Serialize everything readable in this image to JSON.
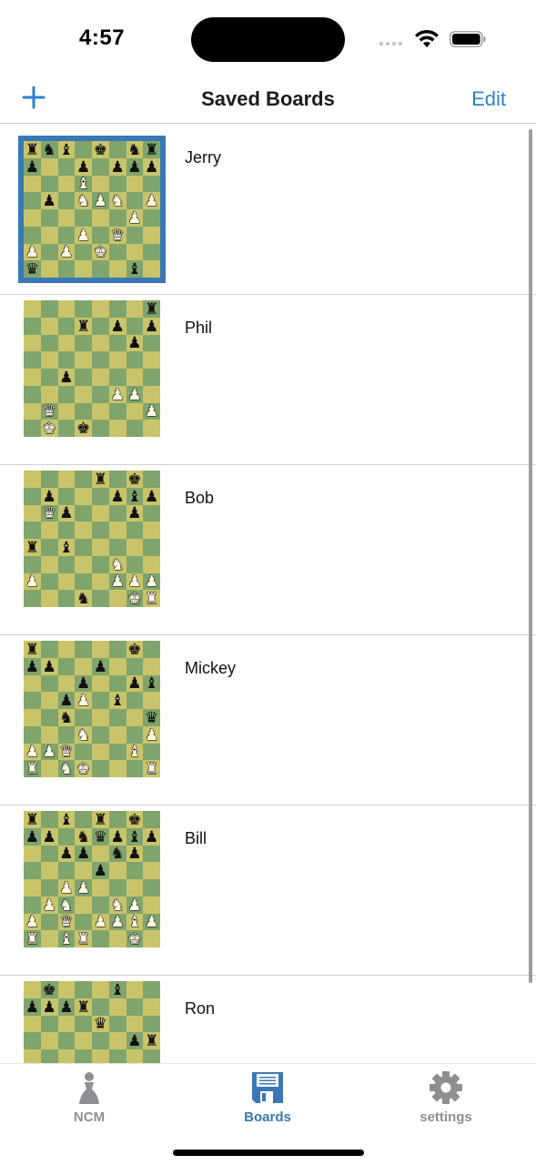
{
  "status_bar": {
    "time": "4:57"
  },
  "nav": {
    "title": "Saved Boards",
    "add_icon": "plus-icon",
    "edit_label": "Edit"
  },
  "colors": {
    "accent": "#2f80d1",
    "tab_active": "#3a78b5",
    "tab_inactive": "#8e8e93",
    "light_square": "#c9c46a",
    "dark_square": "#80a56c",
    "selection_border": "#3a78b5"
  },
  "boards": [
    {
      "name": "Jerry",
      "selected": true,
      "ranks": [
        "rnb.k.nr",
        "p..p.ppp",
        "...B....",
        ".p.NPN.P",
        "......P.",
        "...P.Q..",
        "P.P.K...",
        "q.....b."
      ]
    },
    {
      "name": "Phil",
      "selected": false,
      "ranks": [
        ".......r",
        "...r.p.p",
        "......p.",
        "........",
        "..p.....",
        ".....PP.",
        ".Q.....P",
        ".K.k...."
      ]
    },
    {
      "name": "Bob",
      "selected": false,
      "ranks": [
        "....r.k.",
        ".p...pbp",
        ".Qp...p.",
        "........",
        "r.b.....",
        ".....N..",
        "P....PPP",
        "...n..KR"
      ]
    },
    {
      "name": "Mickey",
      "selected": false,
      "ranks": [
        "r.....k.",
        "pp..p...",
        "...p..pb",
        "..pP.b..",
        "..n....q",
        "...N...P",
        "PPQ...B.",
        "R.NK...R"
      ]
    },
    {
      "name": "Bill",
      "selected": false,
      "ranks": [
        "r.b.r.k.",
        "pp.nqpbp",
        "..pp.np.",
        "....p...",
        "..PP....",
        ".PN..NP.",
        "P.Q.PPBP",
        "R.BR..K."
      ]
    },
    {
      "name": "Ron",
      "selected": false,
      "ranks": [
        ".k...b..",
        "pppr....",
        "....q...",
        "......pr",
        "????????",
        "????????",
        "????????",
        "????????"
      ]
    }
  ],
  "tabs": [
    {
      "label": "NCM",
      "icon": "pawn-icon",
      "active": false
    },
    {
      "label": "Boards",
      "icon": "floppy-disk-icon",
      "active": true
    },
    {
      "label": "settings",
      "icon": "gear-icon",
      "active": false
    }
  ]
}
